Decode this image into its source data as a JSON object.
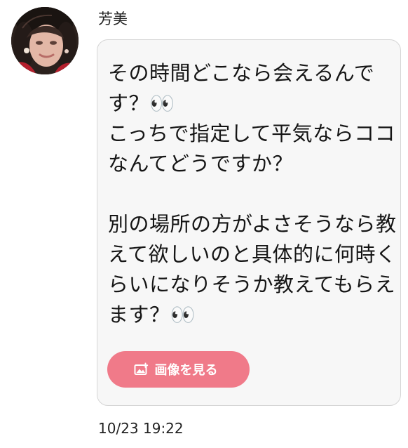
{
  "message": {
    "sender_name": "芳美",
    "text": "その時間どこなら会えるんです？👀\nこっちで指定して平気ならココなんてどうですか？\n\n別の場所の方がよさそうなら教えて欲しいのと具体的に何時くらいになりそうか教えてもらえます？👀",
    "view_image_label": "画像を見る",
    "timestamp": "10/23 19:22"
  },
  "icons": {
    "avatar": "profile-photo",
    "view_image": "image-plus-icon"
  },
  "colors": {
    "button_background": "#f07a89",
    "bubble_background": "#f7f7f7",
    "bubble_border": "#d5d5d5",
    "text": "#151515"
  }
}
